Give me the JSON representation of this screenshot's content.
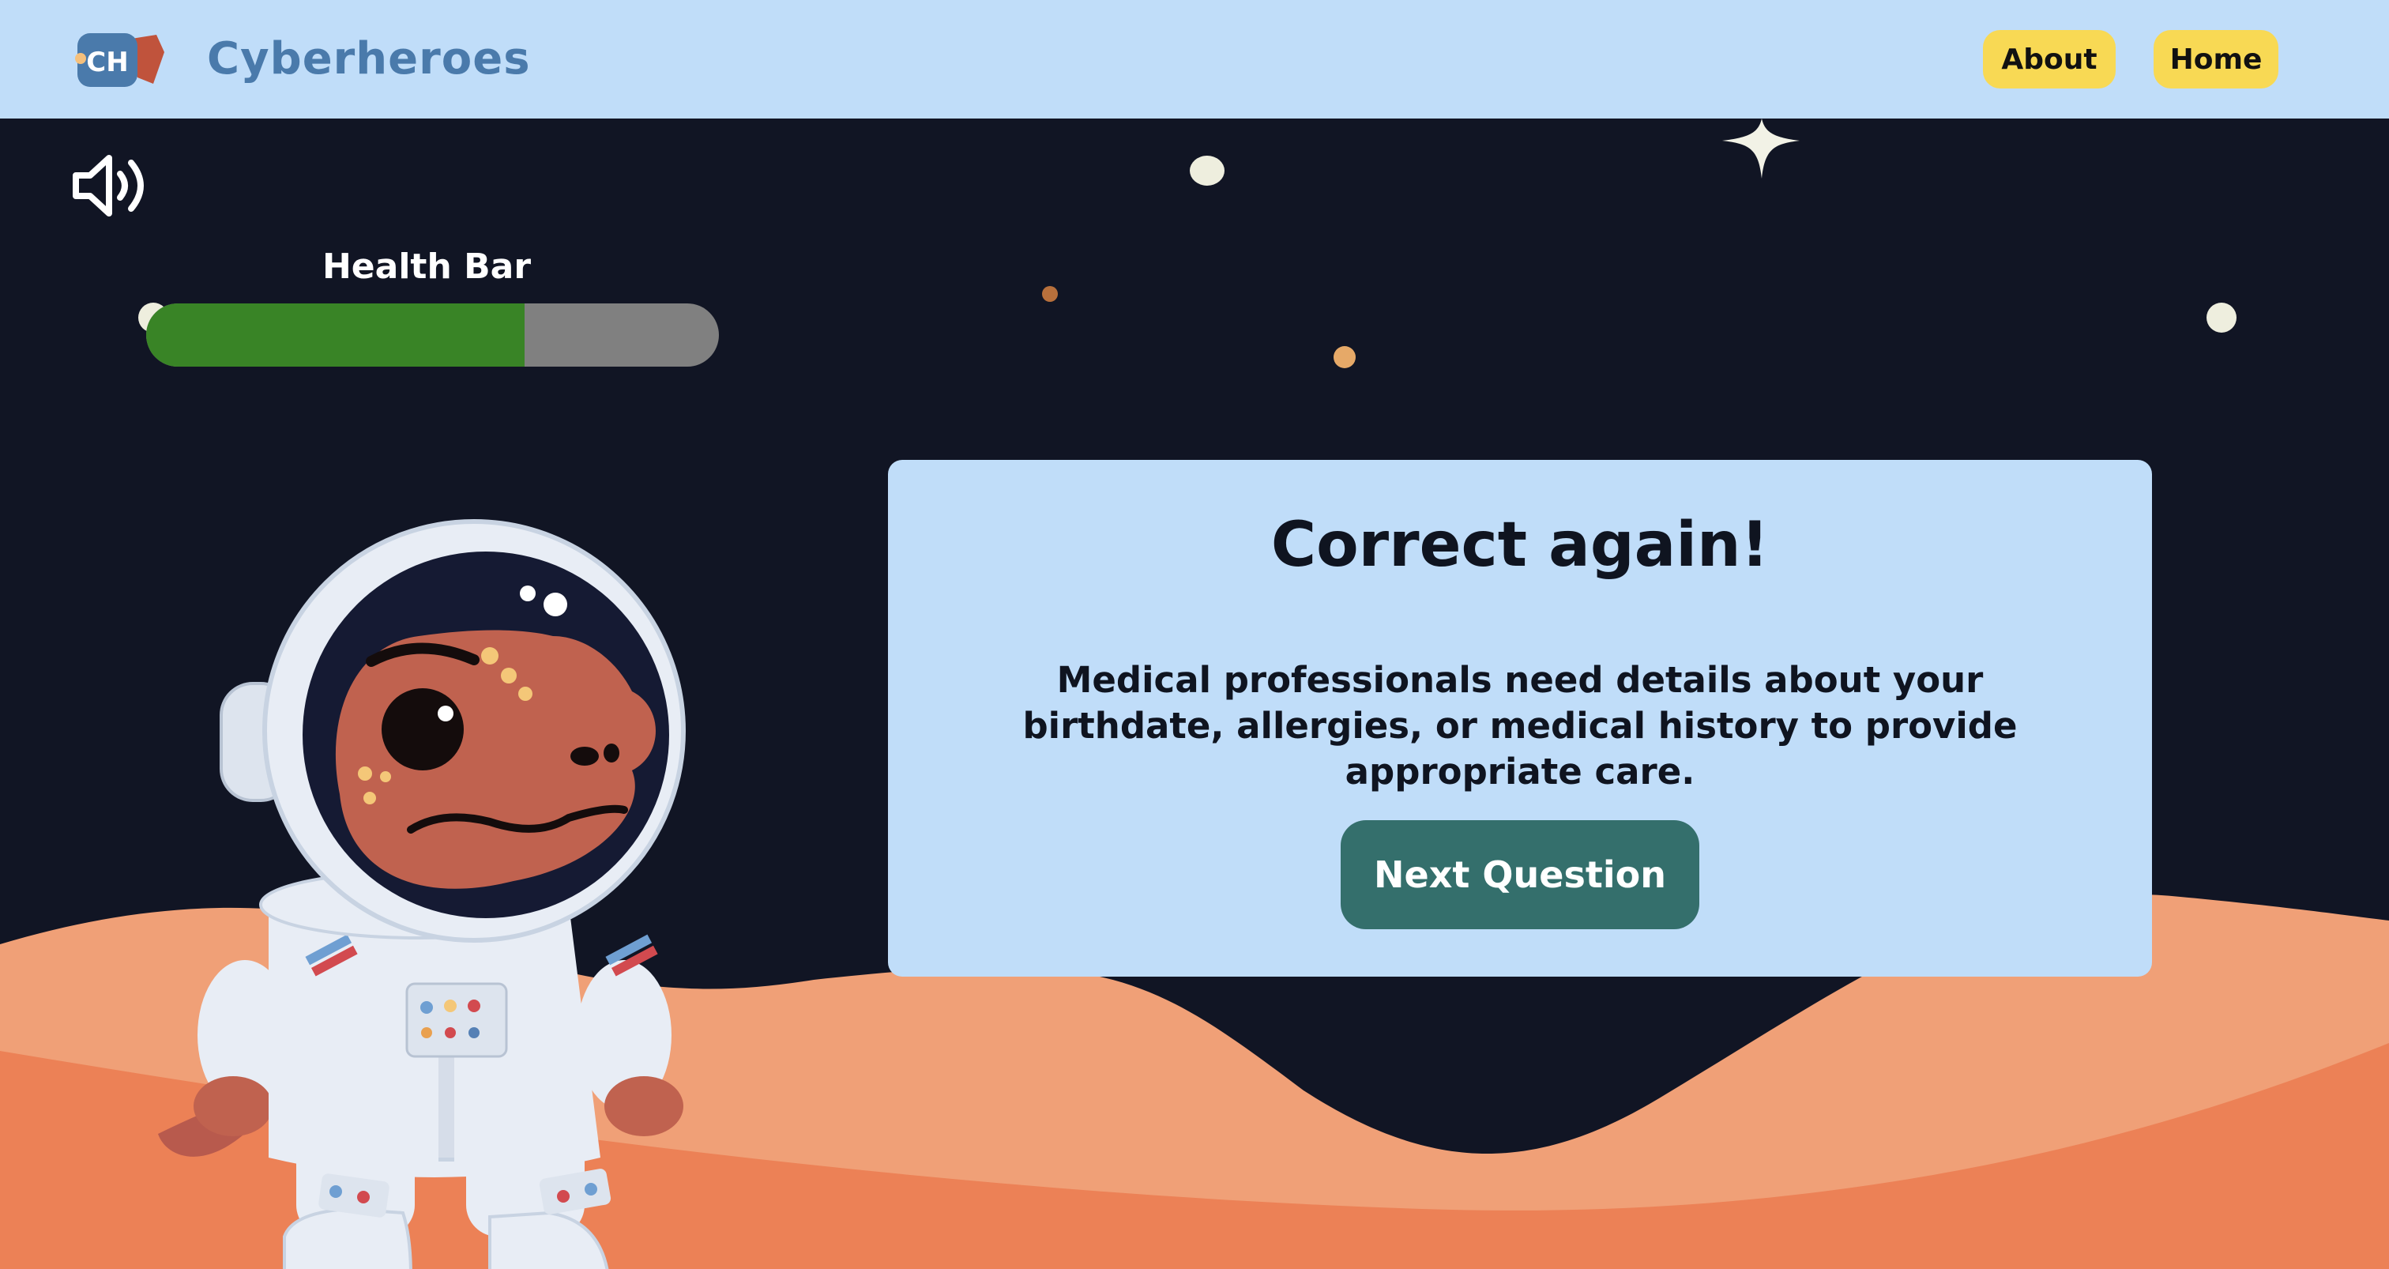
{
  "header": {
    "brand": "Cyberheroes",
    "logo_text": "CH",
    "nav": {
      "about": "About",
      "home": "Home"
    }
  },
  "game": {
    "sound_icon": "speaker-volume-icon",
    "health_bar_label": "Health Bar",
    "health_fraction": 0.66
  },
  "feedback": {
    "title": "Correct again!",
    "message": "Medical professionals need details about your birthdate, allergies, or medical history to provide appropriate care.",
    "next_label": "Next Question"
  },
  "colors": {
    "header_bg": "#c0ddf9",
    "space_bg": "#111524",
    "nav_button": "#f8d954",
    "health_fill": "#398426",
    "health_track": "#808080",
    "card_bg": "#c0ddf9",
    "next_button": "#346f6c",
    "brand_text": "#4a7aab"
  }
}
